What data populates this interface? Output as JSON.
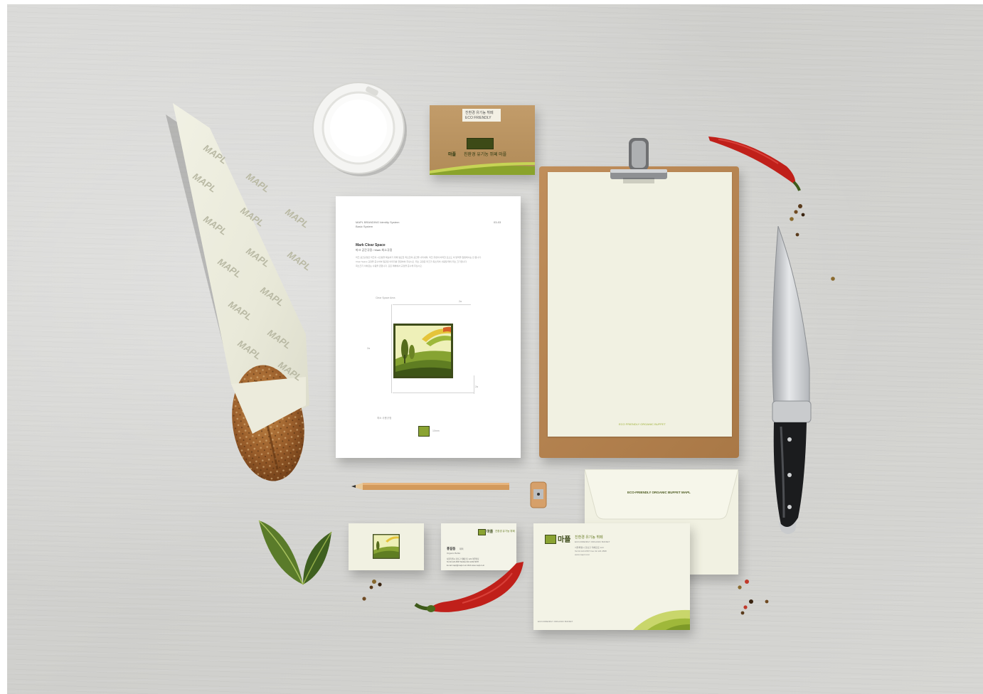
{
  "brand": {
    "wordmark": "MAPL",
    "colors": {
      "olive": "#6b7f2a",
      "lime": "#a9be3a",
      "cream": "#f1f1e2",
      "kraft": "#b48a5a",
      "chili": "#c0201a"
    }
  },
  "wrap": {
    "pattern_word": "MAPL"
  },
  "guide_sheet": {
    "header_left_line1": "MAPL BRANDING Identity System",
    "header_left_line2": "Basic System",
    "header_right": "03-03",
    "section_title": "Mark Clear Space",
    "section_sub": "마크 공간규정 / Mark 최소규정",
    "body_line1": "마크 공간규정은 마크의 시인성을 확보하기 위해 필요한 최소한의 공간을 나타내며, 마크 주변의 어떠한 요소도 이 영역을 침범해서는 안 됩니다.",
    "body_line2": "Clear Space 규정을 준수하여 일관된 이미지를 전달하여 주십시오. 최소 규정은 마크가 축소되어 사용될 때의 최소 크기입니다.",
    "body_line3": "최소크기 이하로는 사용을 금합니다. 모든 매체에서 규정을 준수해 주십시오.",
    "dim_top_label": "Clear Space Area",
    "dim_x": "2a",
    "dim_side": "2a",
    "dim_bottom": "2a",
    "min_label": "최소 사용규정",
    "min_size": "10mm"
  },
  "clipboard": {
    "footer": "ECO FRIENDLY ORGANIC BUFFET"
  },
  "sleeve": {
    "label_line1": "친환경 유기농 뷔페",
    "label_line2": "ECO FRIENDLY",
    "brand_kr": "마플",
    "tagline": "친환경 유기농 뷔페 마플"
  },
  "envelope_back": {
    "text": "ECO-FRIENDLY ORGANIC BUFFET MAPL"
  },
  "envelope_front": {
    "brand_kr": "마플",
    "tagline_kr": "친환경 유기농 뷔페",
    "sub": "ECO-FRIENDLY ORGANIC BUFFET",
    "addr1": "서울특별시 강남구 테헤란로 123",
    "addr2": "Tel 02.123.4567  Fax 02.123.4568",
    "addr3": "www.mapl.co.kr",
    "footer": "ECO-FRIENDLY ORGANIC BUFFET"
  },
  "business_card": {
    "brand_kr": "마플",
    "tagline_kr": "친환경 유기농 뷔페",
    "name": "홍길동",
    "title": "대리",
    "dept": "Organic Buffet",
    "line1": "서울특별시 강남구 테헤란로 123 마플빌딩",
    "line2": "Tel 02.123.4567  Mobile 010.1234.5678",
    "line3": "E-mail mapl@mapl.co.kr  Web www.mapl.co.kr"
  }
}
